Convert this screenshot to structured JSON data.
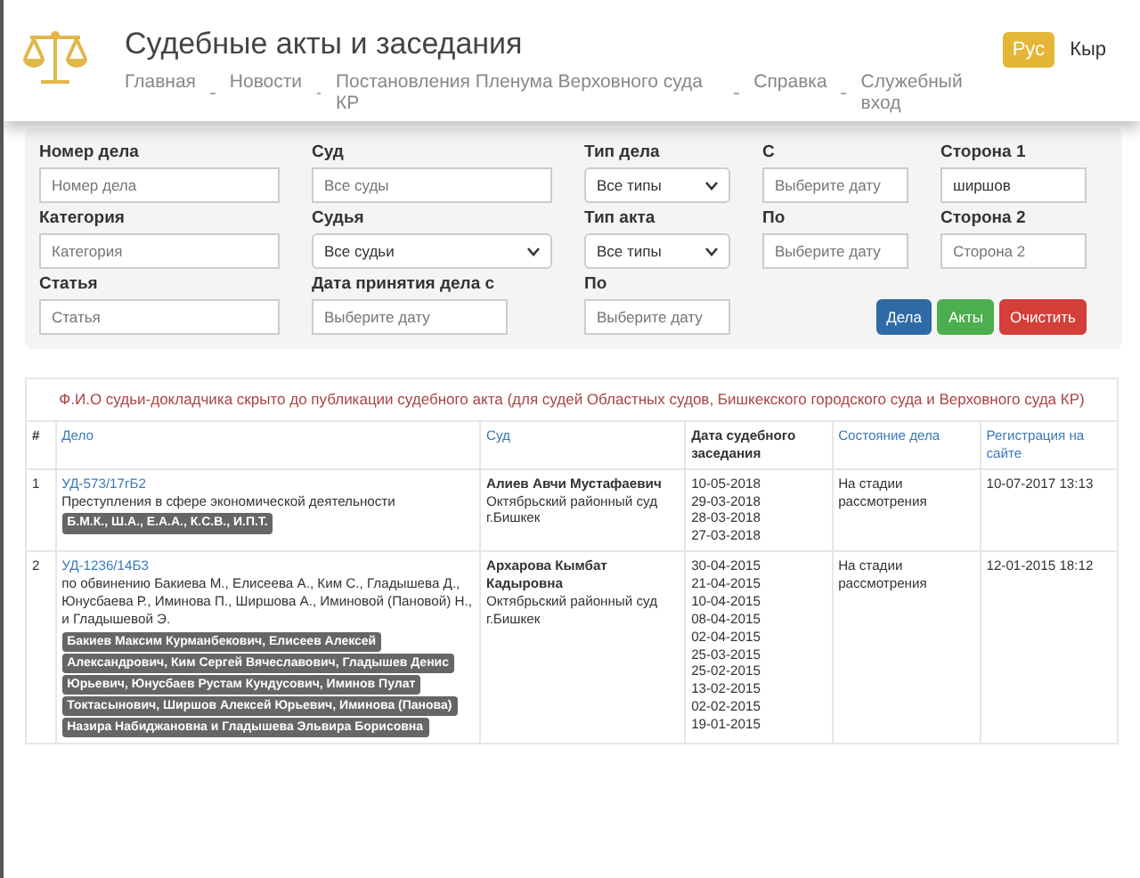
{
  "header": {
    "title": "Судебные акты и заседания",
    "nav": [
      "Главная",
      "Новости",
      "Постановления Пленума Верховного суда КР",
      "Справка",
      "Служебный вход"
    ],
    "languages": [
      {
        "label": "Рус",
        "selected": true
      },
      {
        "label": "Кыр",
        "selected": false
      }
    ]
  },
  "filters": {
    "fields": [
      {
        "label": "Номер дела",
        "kind": "text",
        "placeholder": "Номер дела"
      },
      {
        "label": "Суд",
        "kind": "text",
        "placeholder": "Все суды"
      },
      {
        "label": "Тип дела",
        "kind": "select",
        "value": "Все типы"
      },
      {
        "label": "С",
        "kind": "date",
        "placeholder": "Выберите дату"
      },
      {
        "label": "Сторона 1",
        "kind": "text",
        "value": "ширшов"
      },
      {
        "label": "Категория",
        "kind": "text",
        "placeholder": "Категория"
      },
      {
        "label": "Судья",
        "kind": "select",
        "value": "Все судьи"
      },
      {
        "label": "Тип акта",
        "kind": "select",
        "value": "Все типы"
      },
      {
        "label": "По",
        "kind": "date",
        "placeholder": "Выберите дату"
      },
      {
        "label": "Сторона 2",
        "kind": "text",
        "placeholder": "Сторона 2"
      },
      {
        "label": "Статья",
        "kind": "text",
        "placeholder": "Статья"
      },
      {
        "label": "Дата принятия дела с",
        "kind": "date",
        "placeholder": "Выберите дату"
      },
      {
        "label": "По",
        "kind": "date",
        "placeholder": "Выберите дату"
      }
    ],
    "buttons": [
      {
        "label": "Дела",
        "kind": "primary"
      },
      {
        "label": "Акты",
        "kind": "success"
      },
      {
        "label": "Очистить",
        "kind": "danger"
      }
    ]
  },
  "table": {
    "notice": "Ф.И.О судьи-докладчика скрыто до публикации судебного акта (для судей Областных судов, Бишкекского городского суда и Верховного суда КР)",
    "columns": [
      {
        "label": "#",
        "sortable": false
      },
      {
        "label": "Дело",
        "sortable": true
      },
      {
        "label": "Суд",
        "sortable": true
      },
      {
        "label": "Дата судебного заседания",
        "sortable": false
      },
      {
        "label": "Состояние дела",
        "sortable": true
      },
      {
        "label": "Регистрация на сайте",
        "sortable": true
      }
    ],
    "rows": [
      {
        "number": "1",
        "case_number": "УД-573/17гБ2",
        "description": "Преступления в сфере экономической деятельности",
        "parties": [
          "Б.М.К., Ш.А., Е.А.А., К.С.В., И.П.Т."
        ],
        "judge": "Алиев Авчи Мустафаевич",
        "court": "Октябрьский районный суд г.Бишкек",
        "dates": [
          "10-05-2018",
          "29-03-2018",
          "28-03-2018",
          "27-03-2018"
        ],
        "status": "На стадии рассмотрения",
        "registered": "10-07-2017 13:13"
      },
      {
        "number": "2",
        "case_number": "УД-1236/14Б3",
        "description": "по обвинению Бакиева М., Елисеева А., Ким С., Гладышева Д., Юнусбаева Р., Иминова П., Ширшова А., Иминовой (Пановой) Н., и Гладышевой Э.",
        "parties": [
          "Бакиев Максим Курманбекович, Елисеев Алексей",
          "Александрович, Ким Сергей Вячеславович, Гладышев Денис",
          "Юрьевич, Юнусбаев Рустам Кундусович, Иминов Пулат",
          "Токтасынович, Ширшов Алексей Юрьевич, Иминова (Панова)",
          "Назира Набиджановна и Гладышева Эльвира Борисовна"
        ],
        "judge": "Архарова Кымбат Кадыровна",
        "court": "Октябрьский районный суд г.Бишкек",
        "dates": [
          "30-04-2015",
          "21-04-2015",
          "10-04-2015",
          "08-04-2015",
          "02-04-2015",
          "25-03-2015",
          "25-02-2015",
          "13-02-2015",
          "02-02-2015",
          "19-01-2015"
        ],
        "status": "На стадии рассмотрения",
        "registered": "12-01-2015 18:12"
      }
    ]
  }
}
